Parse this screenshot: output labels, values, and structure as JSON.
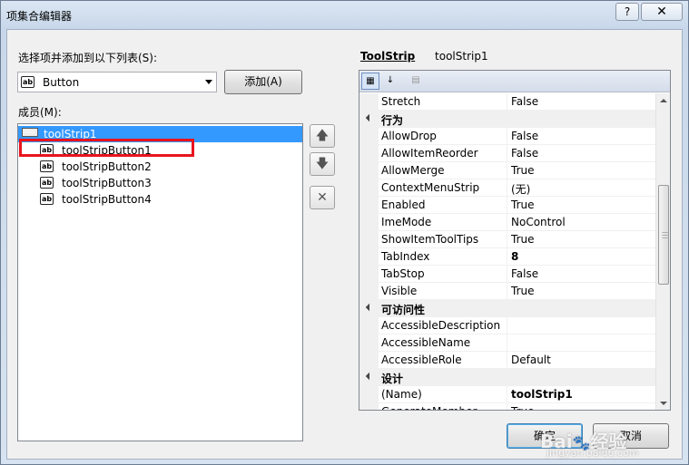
{
  "window": {
    "title": "项集合编辑器",
    "help": "?",
    "close": "✕"
  },
  "left": {
    "add_label": "选择项并添加到以下列表(S):",
    "combo_value": "Button",
    "combo_icon": "ab",
    "add_button": "添加(A)",
    "members_label": "成员(M):",
    "members": [
      {
        "label": "toolStrip1",
        "type": "toolstrip",
        "selected": true
      },
      {
        "label": "toolStripButton1",
        "type": "button",
        "highlighted": true
      },
      {
        "label": "toolStripButton2",
        "type": "button"
      },
      {
        "label": "toolStripButton3",
        "type": "button"
      },
      {
        "label": "toolStripButton4",
        "type": "button"
      }
    ],
    "move_up_icon": "arrow-up-icon",
    "move_down_icon": "arrow-down-icon",
    "delete_icon": "delete-x-icon"
  },
  "right": {
    "object_class": "ToolStrip",
    "object_name": "toolStrip1",
    "toolbar_icons": [
      "categorized-icon",
      "alphabetical-icon",
      "property-pages-icon"
    ],
    "rows": [
      {
        "kind": "prop",
        "name": "Stretch",
        "value": "False"
      },
      {
        "kind": "cat",
        "name": "行为"
      },
      {
        "kind": "prop",
        "name": "AllowDrop",
        "value": "False"
      },
      {
        "kind": "prop",
        "name": "AllowItemReorder",
        "value": "False"
      },
      {
        "kind": "prop",
        "name": "AllowMerge",
        "value": "True"
      },
      {
        "kind": "prop",
        "name": "ContextMenuStrip",
        "value": "(无)"
      },
      {
        "kind": "prop",
        "name": "Enabled",
        "value": "True"
      },
      {
        "kind": "prop",
        "name": "ImeMode",
        "value": "NoControl"
      },
      {
        "kind": "prop",
        "name": "ShowItemToolTips",
        "value": "True"
      },
      {
        "kind": "prop",
        "name": "TabIndex",
        "value": "8",
        "bold": true
      },
      {
        "kind": "prop",
        "name": "TabStop",
        "value": "False"
      },
      {
        "kind": "prop",
        "name": "Visible",
        "value": "True"
      },
      {
        "kind": "cat",
        "name": "可访问性"
      },
      {
        "kind": "prop",
        "name": "AccessibleDescription",
        "value": ""
      },
      {
        "kind": "prop",
        "name": "AccessibleName",
        "value": ""
      },
      {
        "kind": "prop",
        "name": "AccessibleRole",
        "value": "Default"
      },
      {
        "kind": "cat",
        "name": "设计"
      },
      {
        "kind": "prop",
        "name": "(Name)",
        "value": "toolStrip1",
        "bold": true
      },
      {
        "kind": "prop",
        "name": "GenerateMember",
        "value": "True"
      }
    ]
  },
  "footer": {
    "ok": "确定",
    "cancel": "取消"
  }
}
